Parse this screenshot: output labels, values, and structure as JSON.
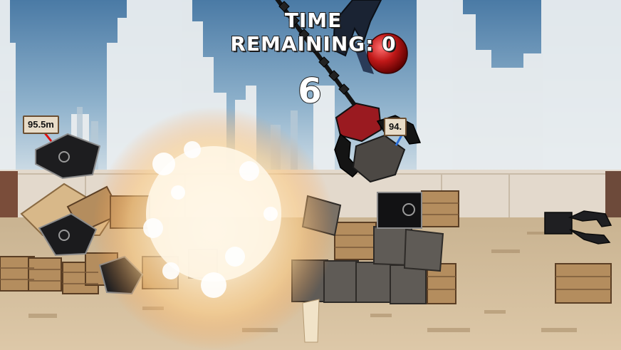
{
  "hud": {
    "time_remaining_label": "TIME REMAINING: 0",
    "countdown": "6"
  },
  "distance_markers": {
    "left": "95.5m",
    "right": "94."
  },
  "colors": {
    "sky_top": "#4f7ea7",
    "sky_bottom": "#c9dbe6",
    "floor": "#d3bfa0",
    "wall": "#e6ddd0",
    "claw": "#8b1a1a",
    "wood_crate": "#b08a5e",
    "stone_block": "#5e5a55",
    "explosion": "#ffe0a8"
  }
}
